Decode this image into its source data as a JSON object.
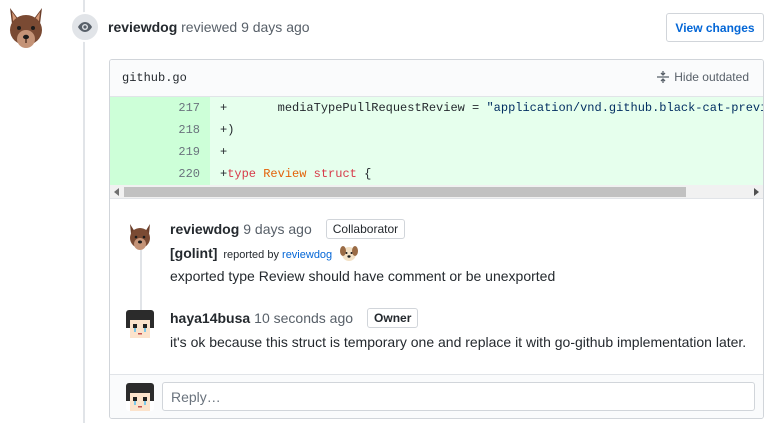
{
  "review": {
    "author": "reviewdog",
    "action": "reviewed",
    "time": "9 days ago",
    "view_changes_label": "View changes",
    "avatar_icon": "wolf-avatar-icon",
    "event_icon": "eye-icon"
  },
  "file": {
    "name": "github.go",
    "hide_outdated_label": "Hide outdated",
    "diff": [
      {
        "num": "217",
        "prefix": "+",
        "indent": "       ",
        "text": "mediaTypePullRequestReview = ",
        "string": "\"application/vnd.github.black-cat-preview+json\""
      },
      {
        "num": "218",
        "prefix": "+",
        "text": ")"
      },
      {
        "num": "219",
        "prefix": "+",
        "text": ""
      },
      {
        "num": "220",
        "prefix": "+",
        "kw1": "type",
        "ty": "Review",
        "kw2": "struct",
        "tail": "{"
      }
    ]
  },
  "comments": [
    {
      "author": "reviewdog",
      "time": "9 days ago",
      "badge": "Collaborator",
      "tag": "[golint]",
      "reported_by_prefix": "reported by",
      "reported_by_user": "reviewdog",
      "body": "exported type Review should have comment or be unexported"
    },
    {
      "author": "haya14busa",
      "time": "10 seconds ago",
      "badge": "Owner",
      "body": "it's ok because this struct is temporary one and replace it with go-github implementation later."
    }
  ],
  "reply": {
    "placeholder": "Reply…"
  },
  "colors": {
    "link": "#0366d6",
    "diff_added_bg": "#e6ffed",
    "diff_added_num_bg": "#cdffd8"
  }
}
